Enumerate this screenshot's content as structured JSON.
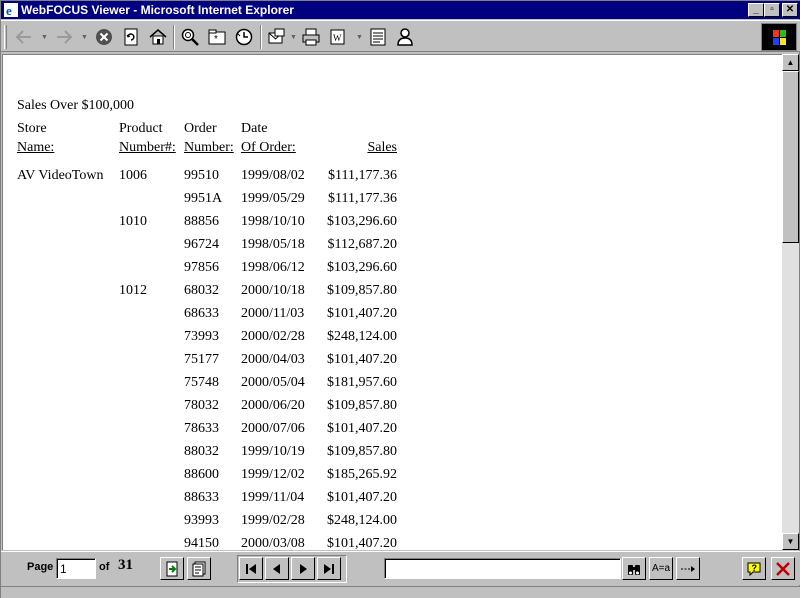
{
  "window": {
    "title": "WebFOCUS Viewer - Microsoft Internet Explorer",
    "minimize": "_",
    "restore": "▫",
    "close": "✕"
  },
  "toolbar": {
    "icons": [
      "back-icon",
      "forward-icon",
      "stop-icon",
      "refresh-icon",
      "home-icon",
      "search-icon",
      "favorites-icon",
      "history-icon",
      "mail-icon",
      "print-icon",
      "edit-icon",
      "discuss-icon",
      "messenger-icon"
    ]
  },
  "report": {
    "title": "Sales Over $100,000",
    "headers": {
      "store": [
        "Store",
        "Name:"
      ],
      "product": [
        "Product",
        "Number#:"
      ],
      "order": [
        "Order",
        "Number:"
      ],
      "date": [
        "Date",
        "Of Order:"
      ],
      "sales": "Sales"
    },
    "rows": [
      {
        "store": "AV VideoTown",
        "product": "1006",
        "order": "99510",
        "date": "1999/08/02",
        "sales": "$111,177.36"
      },
      {
        "store": "",
        "product": "",
        "order": "9951A",
        "date": "1999/05/29",
        "sales": "$111,177.36"
      },
      {
        "store": "",
        "product": "1010",
        "order": "88856",
        "date": "1998/10/10",
        "sales": "$103,296.60"
      },
      {
        "store": "",
        "product": "",
        "order": "96724",
        "date": "1998/05/18",
        "sales": "$112,687.20"
      },
      {
        "store": "",
        "product": "",
        "order": "97856",
        "date": "1998/06/12",
        "sales": "$103,296.60"
      },
      {
        "store": "",
        "product": "1012",
        "order": "68032",
        "date": "2000/10/18",
        "sales": "$109,857.80"
      },
      {
        "store": "",
        "product": "",
        "order": "68633",
        "date": "2000/11/03",
        "sales": "$101,407.20"
      },
      {
        "store": "",
        "product": "",
        "order": "73993",
        "date": "2000/02/28",
        "sales": "$248,124.00"
      },
      {
        "store": "",
        "product": "",
        "order": "75177",
        "date": "2000/04/03",
        "sales": "$101,407.20"
      },
      {
        "store": "",
        "product": "",
        "order": "75748",
        "date": "2000/05/04",
        "sales": "$181,957.60"
      },
      {
        "store": "",
        "product": "",
        "order": "78032",
        "date": "2000/06/20",
        "sales": "$109,857.80"
      },
      {
        "store": "",
        "product": "",
        "order": "78633",
        "date": "2000/07/06",
        "sales": "$101,407.20"
      },
      {
        "store": "",
        "product": "",
        "order": "88032",
        "date": "1999/10/19",
        "sales": "$109,857.80"
      },
      {
        "store": "",
        "product": "",
        "order": "88600",
        "date": "1999/12/02",
        "sales": "$185,265.92"
      },
      {
        "store": "",
        "product": "",
        "order": "88633",
        "date": "1999/11/04",
        "sales": "$101,407.20"
      },
      {
        "store": "",
        "product": "",
        "order": "93993",
        "date": "1999/02/28",
        "sales": "$248,124.00"
      },
      {
        "store": "",
        "product": "",
        "order": "94150",
        "date": "2000/03/08",
        "sales": "$101,407.20"
      }
    ]
  },
  "nav": {
    "page_label": "Page",
    "page_value": "1",
    "of_label": "of",
    "total_pages": "31",
    "search_value": "",
    "match_case_label": "A=a",
    "colors": {
      "help": "#ffff00",
      "close": "#c00000"
    }
  }
}
